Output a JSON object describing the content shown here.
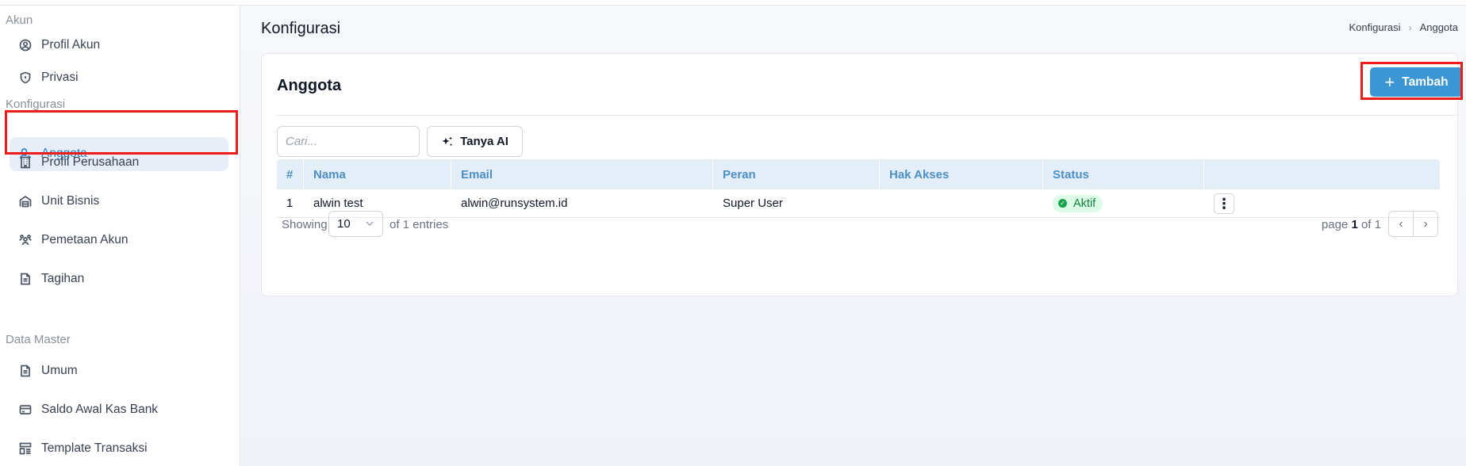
{
  "sidebar": {
    "sections": [
      {
        "title": "Akun"
      },
      {
        "title": "Konfigurasi"
      },
      {
        "title": "Data Master"
      }
    ],
    "items": [
      {
        "label": "Profil Akun",
        "icon": "user-circle-icon"
      },
      {
        "label": "Privasi",
        "icon": "shield-icon"
      },
      {
        "label": "Anggota",
        "icon": "user-plus-icon",
        "active": true
      },
      {
        "label": "Profil Perusahaan",
        "icon": "building-icon"
      },
      {
        "label": "Unit Bisnis",
        "icon": "warehouse-icon"
      },
      {
        "label": "Pemetaan Akun",
        "icon": "users-icon"
      },
      {
        "label": "Tagihan",
        "icon": "file-icon"
      },
      {
        "label": "Umum",
        "icon": "file-icon"
      },
      {
        "label": "Saldo Awal Kas Bank",
        "icon": "credit-card-icon"
      },
      {
        "label": "Template Transaksi",
        "icon": "template-icon"
      }
    ]
  },
  "header": {
    "title": "Konfigurasi",
    "breadcrumb": [
      "Konfigurasi",
      "Anggota"
    ]
  },
  "card": {
    "title": "Anggota",
    "add_label": "Tambah",
    "search_placeholder": "Cari...",
    "ai_label": "Tanya AI"
  },
  "table": {
    "columns": [
      "#",
      "Nama",
      "Email",
      "Peran",
      "Hak Akses",
      "Status",
      ""
    ],
    "rows": [
      {
        "no": "1",
        "nama": "alwin test",
        "email": "alwin@runsystem.id",
        "peran": "Super User",
        "hak_akses": "",
        "status": "Aktif"
      }
    ]
  },
  "pagination": {
    "showing_label": "Showing",
    "page_size": "10",
    "entries_text": "of 1 entries",
    "page_prefix": "page",
    "page_current": "1",
    "page_suffix": "of 1"
  },
  "colors": {
    "accent": "#3b96d3",
    "active_bg": "#e8eef8",
    "status_green": "#16a34a",
    "highlight_red": "#ee1b1b"
  }
}
